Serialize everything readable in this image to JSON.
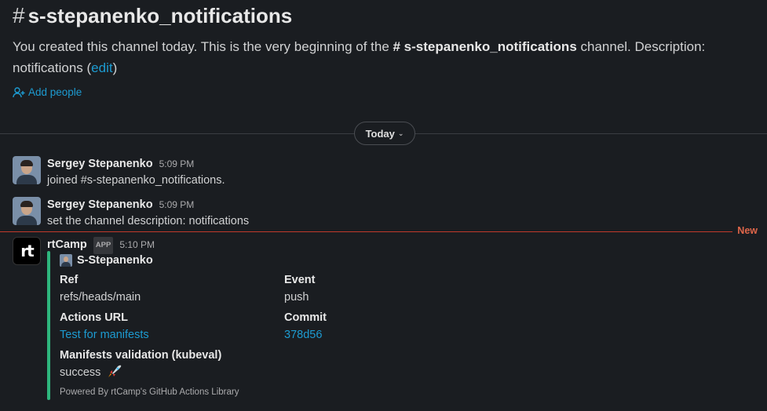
{
  "channel": {
    "hash": "#",
    "name": "s-stepanenko_notifications",
    "intro_prefix": "You created this channel today. This is the very beginning of the ",
    "intro_channel": "# s-stepanenko_notifications",
    "intro_suffix": " channel. Description: notifications (",
    "edit_label": "edit",
    "intro_close": ")",
    "add_people_label": "Add people"
  },
  "date_divider": {
    "label": "Today"
  },
  "messages": [
    {
      "author": "Sergey Stepanenko",
      "time": "5:09 PM",
      "text": "joined #s-stepanenko_notifications."
    },
    {
      "author": "Sergey Stepanenko",
      "time": "5:09 PM",
      "text": "set the channel description: notifications"
    }
  ],
  "new_marker": "New",
  "app_message": {
    "author": "rtCamp",
    "badge": "APP",
    "time": "5:10 PM",
    "avatar_text": "rt",
    "attachment": {
      "author_name": "S-Stepanenko",
      "fields": [
        {
          "title": "Ref",
          "value": "refs/heads/main",
          "link": false
        },
        {
          "title": "Event",
          "value": "push",
          "link": false
        },
        {
          "title": "Actions URL",
          "value": "Test for manifests",
          "link": true
        },
        {
          "title": "Commit",
          "value": "378d56",
          "link": true
        }
      ],
      "wide_field": {
        "title": "Manifests validation (kubeval)",
        "value": "success"
      },
      "footer": "Powered By rtCamp's GitHub Actions Library",
      "color": "#2eb67d"
    }
  }
}
